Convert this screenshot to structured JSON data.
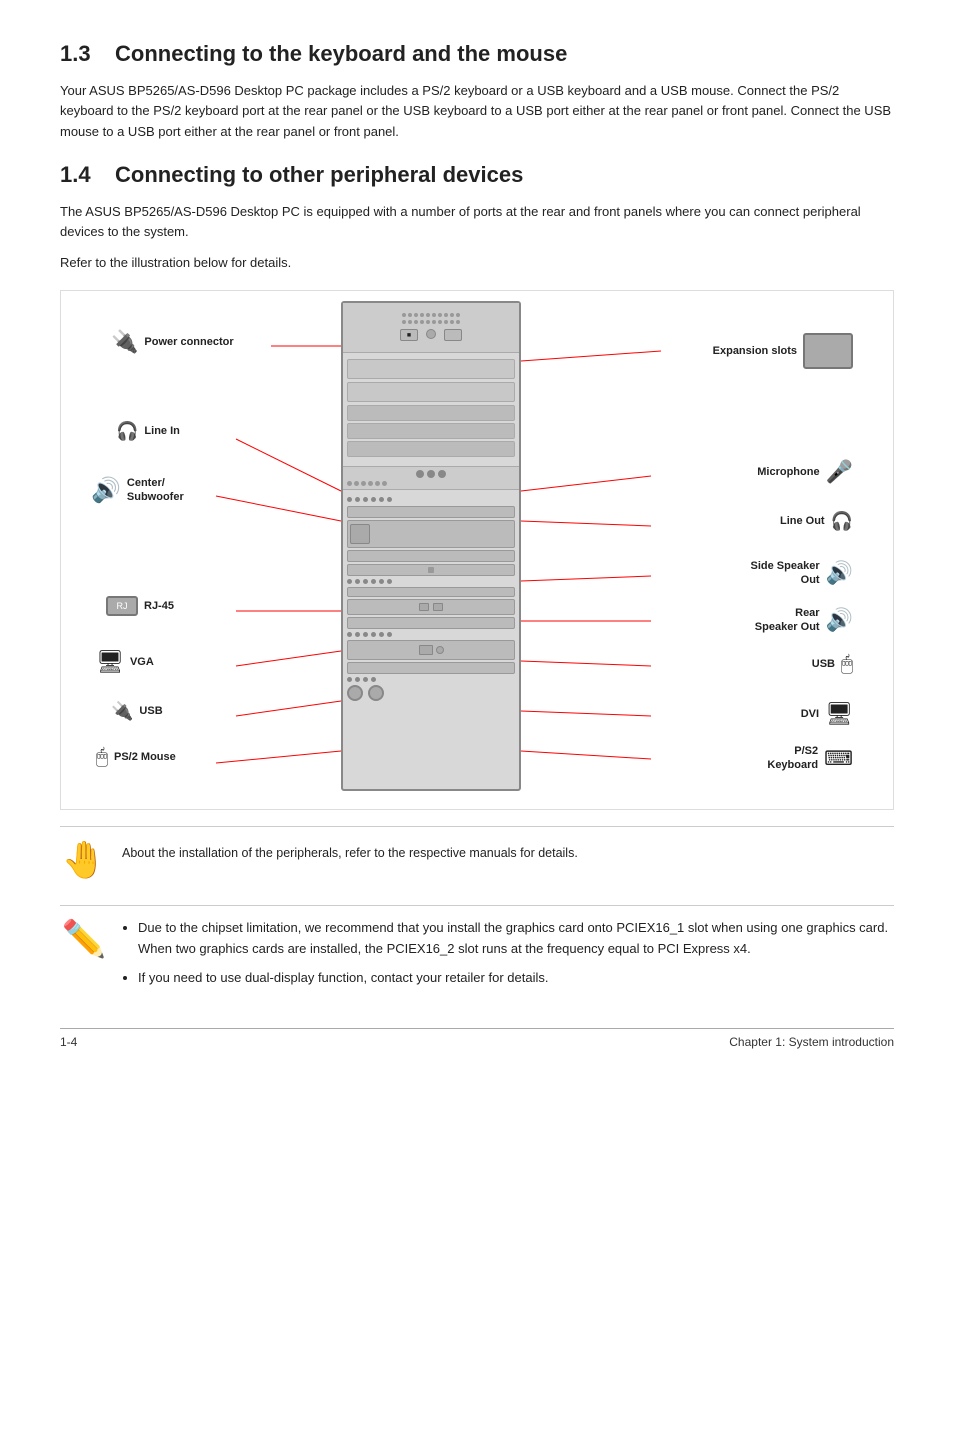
{
  "section13": {
    "number": "1.3",
    "title": "Connecting to the keyboard and the mouse",
    "body": "Your ASUS BP5265/AS-D596 Desktop PC package includes a PS/2 keyboard or a USB keyboard and a USB mouse. Connect the PS/2 keyboard to the PS/2 keyboard port at the rear panel or the USB keyboard to a USB port either at the rear panel or front panel. Connect the USB mouse to a USB port either at the rear panel or front panel."
  },
  "section14": {
    "number": "1.4",
    "title": "Connecting to other peripheral devices",
    "body1": "The ASUS BP5265/AS-D596 Desktop PC is equipped with a number of ports at the rear and front panels where you can connect peripheral devices to the system.",
    "body2": "Refer to the illustration below for details."
  },
  "labels": {
    "left": [
      {
        "id": "power-connector",
        "text": "Power connector"
      },
      {
        "id": "line-in",
        "text": "Line In"
      },
      {
        "id": "center-subwoofer",
        "text": "Center/\nSubwoofer"
      },
      {
        "id": "rj45",
        "text": "RJ-45"
      },
      {
        "id": "vga",
        "text": "VGA"
      },
      {
        "id": "usb-left",
        "text": "USB"
      },
      {
        "id": "ps2-mouse",
        "text": "PS/2 Mouse"
      }
    ],
    "right": [
      {
        "id": "expansion-slots",
        "text": "Expansion slots"
      },
      {
        "id": "microphone",
        "text": "Microphone"
      },
      {
        "id": "line-out",
        "text": "Line Out"
      },
      {
        "id": "side-speaker-out",
        "text": "Side Speaker\nOut"
      },
      {
        "id": "rear-speaker-out",
        "text": "Rear\nSpeaker Out"
      },
      {
        "id": "usb-right",
        "text": "USB"
      },
      {
        "id": "dvi",
        "text": "DVI"
      },
      {
        "id": "ps2-keyboard",
        "text": "P/S2\nKeyboard"
      }
    ]
  },
  "note1": {
    "icon": "✋",
    "text": "About the installation of the peripherals, refer to the respective manuals for details."
  },
  "note2": {
    "icon": "✏️",
    "bullets": [
      "Due to the chipset limitation, we recommend that you install the graphics card onto PCIEX16_1 slot when using one graphics card. When two graphics cards are installed, the PCIEX16_2 slot runs at the frequency equal to PCI Express x4.",
      "If you need to use dual-display function, contact your retailer for details."
    ]
  },
  "footer": {
    "page": "1-4",
    "chapter": "Chapter 1: System introduction"
  }
}
